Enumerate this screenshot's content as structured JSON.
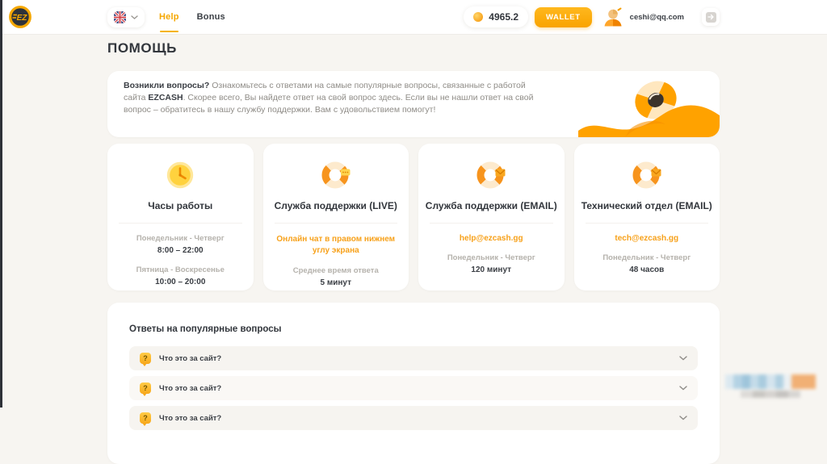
{
  "header": {
    "brand": "EZ",
    "language": {
      "flag_icon": "uk-flag-icon"
    },
    "tabs": [
      {
        "label": "Help",
        "active": true
      },
      {
        "label": "Bonus",
        "active": false
      }
    ],
    "balance": "4965.2",
    "wallet_label": "WALLET",
    "user_email": "ceshi@qq.com"
  },
  "page": {
    "title": "ПОМОЩЬ"
  },
  "banner": {
    "intro_bold": "Возникли вопросы?",
    "text_1": " Ознакомьтесь с ответами на самые популярные вопросы, связанные с работой сайта ",
    "brand_bold": "EZCASH",
    "text_2": ". Скорее всего, Вы найдете ответ на свой вопрос здесь. Если вы не нашли ответ на свой вопрос – обратитесь в нашу службу поддержки. Вам с удовольствием помогут!"
  },
  "cards": [
    {
      "icon": "clock-icon",
      "title": "Часы работы",
      "lines": [
        {
          "muted": "Понедельник - Четверг",
          "strong": "8:00 – 22:00"
        },
        {
          "muted": "Пятница - Воскресенье",
          "strong": "10:00 – 20:00"
        }
      ]
    },
    {
      "icon": "lifebuoy-chat-icon",
      "title": "Служба поддержки (LIVE)",
      "highlight": "Онлайн чат в правом нижнем углу экрана",
      "lines": [
        {
          "muted": "Среднее время ответа",
          "strong": "5 минут"
        }
      ]
    },
    {
      "icon": "lifebuoy-mail-icon",
      "title": "Служба поддержки (EMAIL)",
      "link": "help@ezcash.gg",
      "lines": [
        {
          "muted": "Понедельник - Четверг",
          "strong": "120 минут"
        }
      ]
    },
    {
      "icon": "lifebuoy-mail-icon",
      "title": "Технический отдел (EMAIL)",
      "link": "tech@ezcash.gg",
      "lines": [
        {
          "muted": "Понедельник - Четверг",
          "strong": "48 часов"
        }
      ]
    }
  ],
  "faq": {
    "heading": "Ответы на популярные вопросы",
    "items": [
      {
        "question": "Что это за сайт?"
      },
      {
        "question": "Что это за сайт?"
      },
      {
        "question": "Что это за сайт?"
      }
    ]
  },
  "colors": {
    "accent": "#f5a700",
    "accent_dark": "#f9a300",
    "text_dark": "#32363c",
    "text_muted": "#b5b2ac",
    "page_bg": "#f7f5f1"
  }
}
